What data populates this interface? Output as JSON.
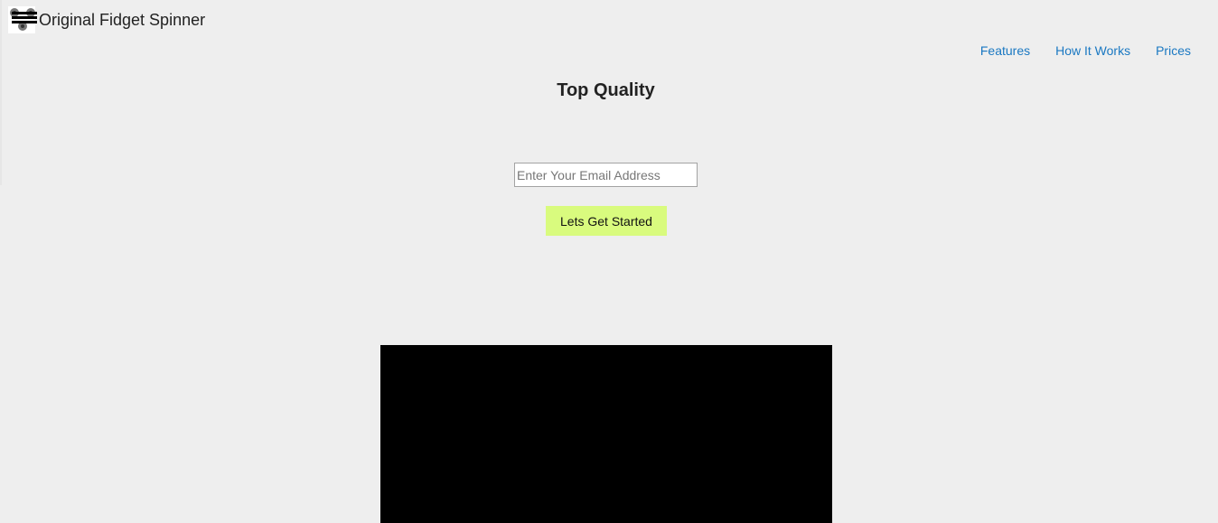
{
  "header": {
    "site_title": "Original Fidget Spinner",
    "logo_icon": "fidget-spinner-hamburger-icon"
  },
  "nav": {
    "items": [
      {
        "label": "Features"
      },
      {
        "label": "How It Works"
      },
      {
        "label": "Prices"
      }
    ]
  },
  "hero": {
    "headline": "Top Quality",
    "email_placeholder": "Enter Your Email Address",
    "cta_label": "Lets Get Started"
  },
  "colors": {
    "background": "#eeeeee",
    "link": "#1a78c2",
    "cta_background": "#d9fb7e",
    "video_background": "#000000"
  }
}
